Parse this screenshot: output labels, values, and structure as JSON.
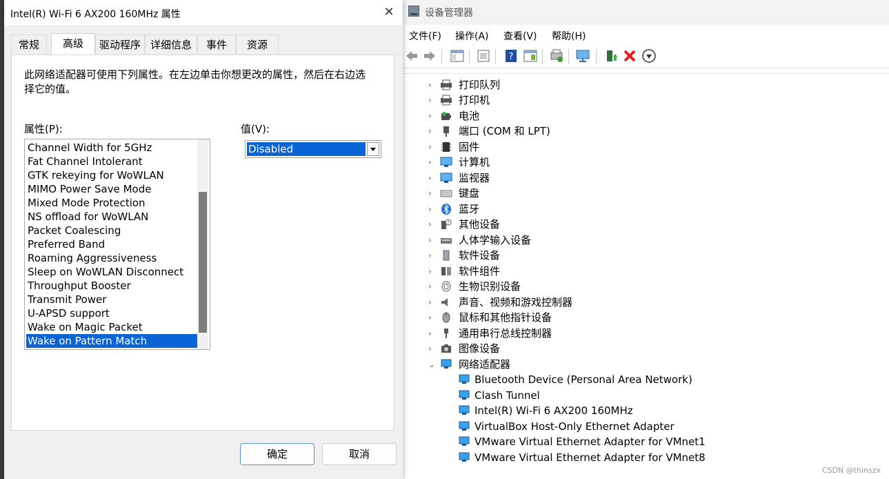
{
  "dialog": {
    "title": "Intel(R) Wi-Fi 6 AX200 160MHz 属性",
    "tabs": [
      "常规",
      "高级",
      "驱动程序",
      "详细信息",
      "事件",
      "资源"
    ],
    "active_tab": "高级",
    "description": "此网络适配器可使用下列属性。在左边单击你想更改的属性，然后在右边选择它的值。",
    "property_label": "属性(P):",
    "value_label": "值(V):",
    "properties": [
      "Channel Width for 5GHz",
      "Fat Channel Intolerant",
      "GTK rekeying for WoWLAN",
      "MIMO Power Save Mode",
      "Mixed Mode Protection",
      "NS offload for WoWLAN",
      "Packet Coalescing",
      "Preferred Band",
      "Roaming Aggressiveness",
      "Sleep on WoWLAN Disconnect",
      "Throughput Booster",
      "Transmit Power",
      "U-APSD support",
      "Wake on Magic Packet",
      "Wake on Pattern Match"
    ],
    "selected_property": "Wake on Pattern Match",
    "value": "Disabled",
    "ok_label": "确定",
    "cancel_label": "取消",
    "selection_color": "#0a64d6"
  },
  "devmgr": {
    "title": "设备管理器",
    "menu": [
      "文件(F)",
      "操作(A)",
      "查看(V)",
      "帮助(H)"
    ],
    "toolbar_icons": [
      "back-icon",
      "forward-icon",
      "show-hide-tree-icon",
      "properties-icon",
      "help-icon",
      "action-view-icon",
      "update-driver-icon",
      "scan-hardware-icon",
      "enable-device-icon",
      "uninstall-device-icon",
      "download-icon"
    ],
    "categories": [
      {
        "label": "打印队列",
        "icon": "print-queue-icon",
        "expanded": false
      },
      {
        "label": "打印机",
        "icon": "printer-icon",
        "expanded": false
      },
      {
        "label": "电池",
        "icon": "battery-icon",
        "expanded": false
      },
      {
        "label": "端口 (COM 和 LPT)",
        "icon": "port-icon",
        "expanded": false
      },
      {
        "label": "固件",
        "icon": "firmware-icon",
        "expanded": false
      },
      {
        "label": "计算机",
        "icon": "computer-icon",
        "expanded": false
      },
      {
        "label": "监视器",
        "icon": "monitor-icon",
        "expanded": false
      },
      {
        "label": "键盘",
        "icon": "keyboard-icon",
        "expanded": false
      },
      {
        "label": "蓝牙",
        "icon": "bluetooth-icon",
        "expanded": false
      },
      {
        "label": "其他设备",
        "icon": "other-devices-icon",
        "expanded": false
      },
      {
        "label": "人体学输入设备",
        "icon": "hid-icon",
        "expanded": false
      },
      {
        "label": "软件设备",
        "icon": "software-device-icon",
        "expanded": false
      },
      {
        "label": "软件组件",
        "icon": "software-component-icon",
        "expanded": false
      },
      {
        "label": "生物识别设备",
        "icon": "biometric-icon",
        "expanded": false
      },
      {
        "label": "声音、视频和游戏控制器",
        "icon": "speaker-icon",
        "expanded": false
      },
      {
        "label": "鼠标和其他指针设备",
        "icon": "mouse-icon",
        "expanded": false
      },
      {
        "label": "通用串行总线控制器",
        "icon": "usb-icon",
        "expanded": false
      },
      {
        "label": "图像设备",
        "icon": "camera-icon",
        "expanded": false
      },
      {
        "label": "网络适配器",
        "icon": "network-adapter-icon",
        "expanded": true
      }
    ],
    "network_adapters": [
      "Bluetooth Device (Personal Area Network)",
      "Clash Tunnel",
      "Intel(R) Wi-Fi 6 AX200 160MHz",
      "VirtualBox Host-Only Ethernet Adapter",
      "VMware Virtual Ethernet Adapter for VMnet1",
      "VMware Virtual Ethernet Adapter for VMnet8"
    ]
  },
  "watermark": "CSDN @thinszx"
}
